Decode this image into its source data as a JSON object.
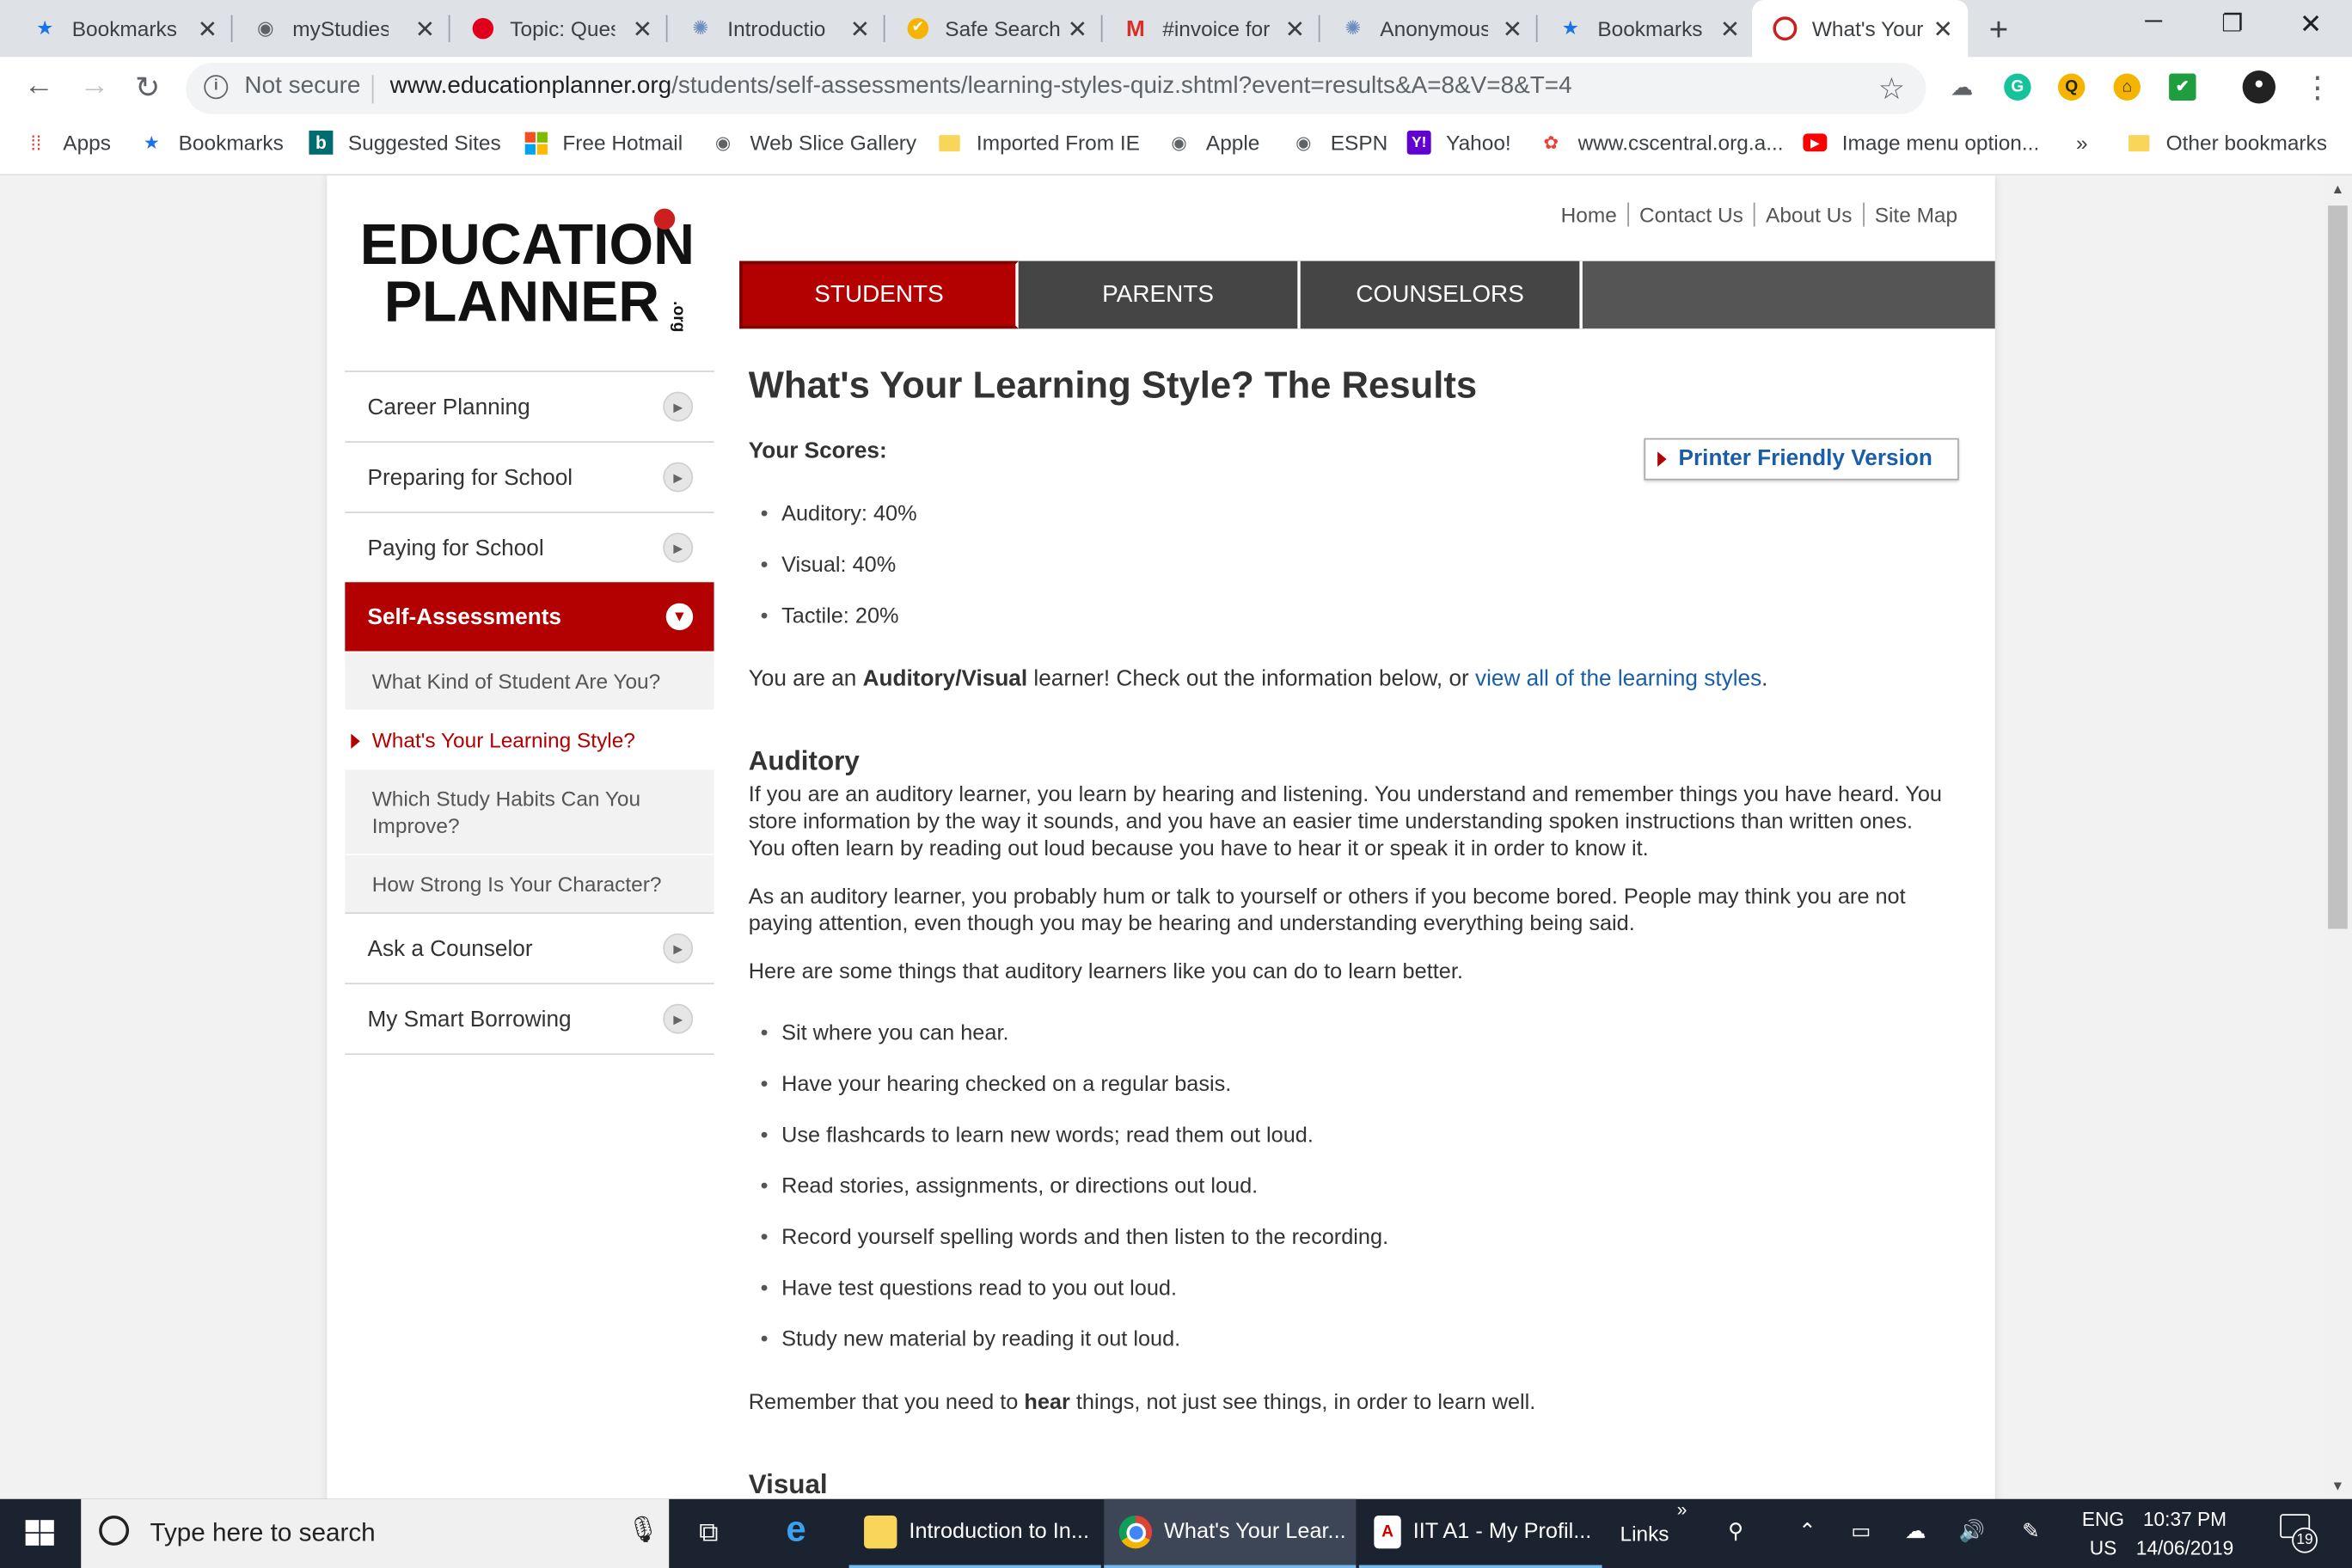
{
  "tabs": [
    {
      "label": "Bookmarks",
      "icon": "star-icon"
    },
    {
      "label": "myStudies",
      "icon": "globe-icon"
    },
    {
      "label": "Topic: Ques",
      "icon": "red-badge-icon"
    },
    {
      "label": "Introductio",
      "icon": "dots-icon"
    },
    {
      "label": "Safe Search",
      "icon": "check-badge-icon"
    },
    {
      "label": "#invoice for",
      "icon": "gmail-icon"
    },
    {
      "label": "Anonymous",
      "icon": "dots-icon"
    },
    {
      "label": "Bookmarks",
      "icon": "star-icon"
    },
    {
      "label": "What's Your",
      "icon": "apple-icon",
      "active": true
    }
  ],
  "toolbar": {
    "security": "Not secure",
    "url_host": "www.educationplanner.org",
    "url_path": "/students/self-assessments/learning-styles-quiz.shtml?event=results&A=8&V=8&T=4"
  },
  "bookmarks_bar": [
    {
      "label": "Apps",
      "icon": "apps-grid-icon"
    },
    {
      "label": "Bookmarks",
      "icon": "star-icon"
    },
    {
      "label": "Suggested Sites",
      "icon": "bing-icon"
    },
    {
      "label": "Free Hotmail",
      "icon": "windows-icon"
    },
    {
      "label": "Web Slice Gallery",
      "icon": "globe-icon"
    },
    {
      "label": "Imported From IE",
      "icon": "folder-icon"
    },
    {
      "label": "Apple",
      "icon": "globe-icon"
    },
    {
      "label": "ESPN",
      "icon": "globe-icon"
    },
    {
      "label": "Yahoo!",
      "icon": "yahoo-icon"
    },
    {
      "label": "www.cscentral.org.a...",
      "icon": "flower-icon"
    },
    {
      "label": "Image menu option...",
      "icon": "youtube-icon"
    },
    {
      "label": "»",
      "icon": "chevron-icon"
    },
    {
      "label": "Other bookmarks",
      "icon": "folder-icon"
    }
  ],
  "site": {
    "logo_line1": "EDUCATION",
    "logo_line2": "PLANNER",
    "logo_org": ".org",
    "util_nav": [
      "Home",
      "Contact Us",
      "About Us",
      "Site Map"
    ],
    "main_nav": [
      "STUDENTS",
      "PARENTS",
      "COUNSELORS"
    ]
  },
  "sidebar": {
    "items": [
      {
        "label": "Career Planning"
      },
      {
        "label": "Preparing for School"
      },
      {
        "label": "Paying for School"
      },
      {
        "label": "Self-Assessments"
      }
    ],
    "subitems": [
      "What Kind of Student Are You?",
      "What's Your Learning Style?",
      "Which Study Habits Can You Improve?",
      "How Strong Is Your Character?"
    ],
    "items_after": [
      {
        "label": "Ask a Counselor"
      },
      {
        "label": "My Smart Borrowing"
      }
    ]
  },
  "content": {
    "title": "What's Your Learning Style? The Results",
    "scores_label": "Your Scores:",
    "print_label": "Printer Friendly Version",
    "scores": [
      "Auditory: 40%",
      "Visual: 40%",
      "Tactile: 20%"
    ],
    "result_pre": "You are an ",
    "result_type": "Auditory/Visual",
    "result_mid": " learner! Check out the information below, or ",
    "result_link": "view all of the learning styles",
    "result_end": ".",
    "auditory_heading": "Auditory",
    "auditory_p1": "If you are an auditory learner, you learn by hearing and listening. You understand and remember things you have heard. You store information by the way it sounds, and you have an easier time understanding spoken instructions than written ones. You often learn by reading out loud because you have to hear it or speak it in order to know it.",
    "auditory_p2": "As an auditory learner, you probably hum or talk to yourself or others if you become bored. People may think you are not paying attention, even though you may be hearing and understanding everything being said.",
    "auditory_p3": "Here are some things that auditory learners like you can do to learn better.",
    "tips": [
      "Sit where you can hear.",
      "Have your hearing checked on a regular basis.",
      "Use flashcards to learn new words; read them out loud.",
      "Read stories, assignments, or directions out loud.",
      "Record yourself spelling words and then listen to the recording.",
      "Have test questions read to you out loud.",
      "Study new material by reading it out loud."
    ],
    "remember_pre": "Remember that you need to ",
    "remember_bold": "hear",
    "remember_post": " things, not just see things, in order to learn well.",
    "visual_heading": "Visual"
  },
  "taskbar": {
    "search_placeholder": "Type here to search",
    "apps": [
      {
        "label": "Introduction to In...",
        "icon": "file-explorer-icon"
      },
      {
        "label": "What's Your Lear...",
        "icon": "chrome-icon",
        "active": true
      },
      {
        "label": "IIT A1 - My Profil...",
        "icon": "pdf-icon"
      }
    ],
    "links_label": "Links",
    "lang_line1": "ENG",
    "lang_line2": "US",
    "time": "10:37 PM",
    "date": "14/06/2019",
    "notifications": "19"
  },
  "colors": {
    "brand_red": "#b30000",
    "link_blue": "#1a5ea8",
    "nav_dark": "#454545"
  }
}
